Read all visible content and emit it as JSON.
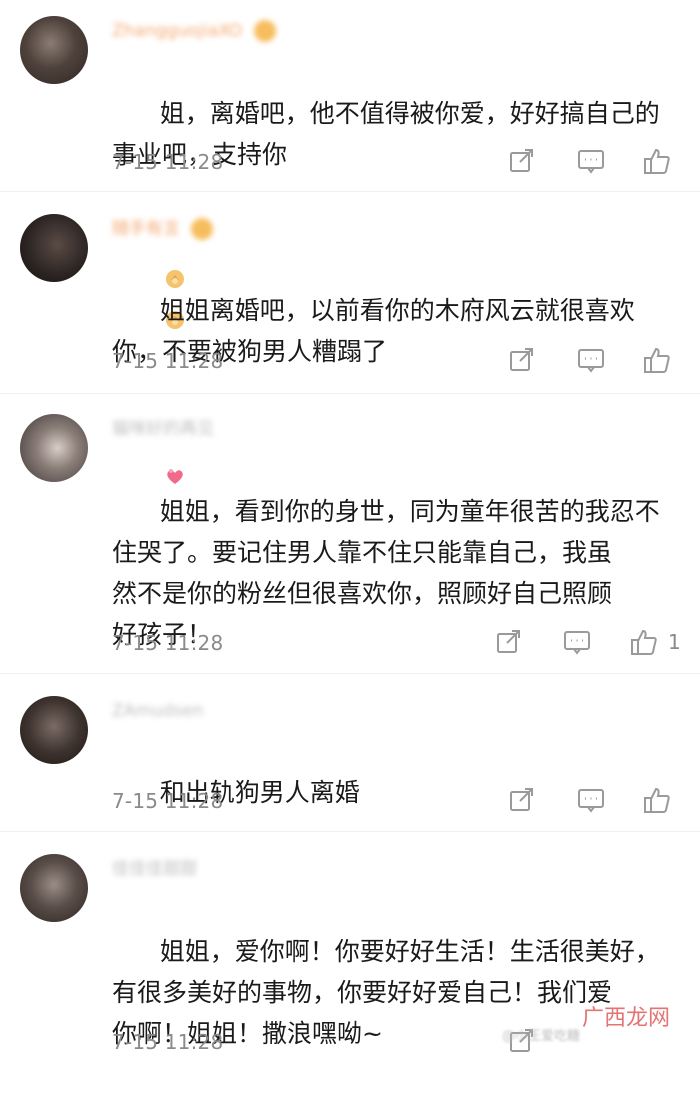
{
  "comments": [
    {
      "username": "ZhangguojiaXO",
      "text": "姐，离婚吧，他不值得被你爱，好好搞自己的\n事业吧，支持你",
      "time": "7-15 11:28",
      "like_count": ""
    },
    {
      "username": "随手有言",
      "text": "姐姐离婚吧，以前看你的木府风云就很喜欢\n你，不要被狗男人糟蹋了",
      "time": "7-15 11:28",
      "like_count": ""
    },
    {
      "username": "猫咪好的再见",
      "text": "姐姐，看到你的身世，同为童年很苦的我忍不\n住哭了。要记住男人靠不住只能靠自己，我虽\n然不是你的粉丝但很喜欢你，照顾好自己照顾\n好孩子！",
      "time": "7-15 11:28",
      "like_count": "1"
    },
    {
      "username": "ZAmudsen",
      "text": "和出轨狗男人离婚",
      "time": "7-15 11:28",
      "like_count": ""
    },
    {
      "username": "佳佳佳甜甜",
      "text": "姐姐，爱你啊！你要好好生活！生活很美好，\n有很多美好的事物，你要好好爱自己！我们爱\n你啊！姐姐！撒浪嘿呦~",
      "time": "7-15 11:28",
      "like_count": ""
    }
  ],
  "icons": {
    "share": "share-icon",
    "comment": "comment-icon",
    "like": "thumbs-up-icon",
    "emoji_clap": "clap-emoji-icon",
    "emoji_hearts": "hearts-emoji-icon"
  },
  "colors": {
    "username_orange": "#f29f62",
    "meta_gray": "#8a8a8a",
    "text": "#1a1a1a",
    "watermark": "#e05b5b"
  },
  "watermark": "广西龙网",
  "watermark_small": "@小王爱吃糖"
}
